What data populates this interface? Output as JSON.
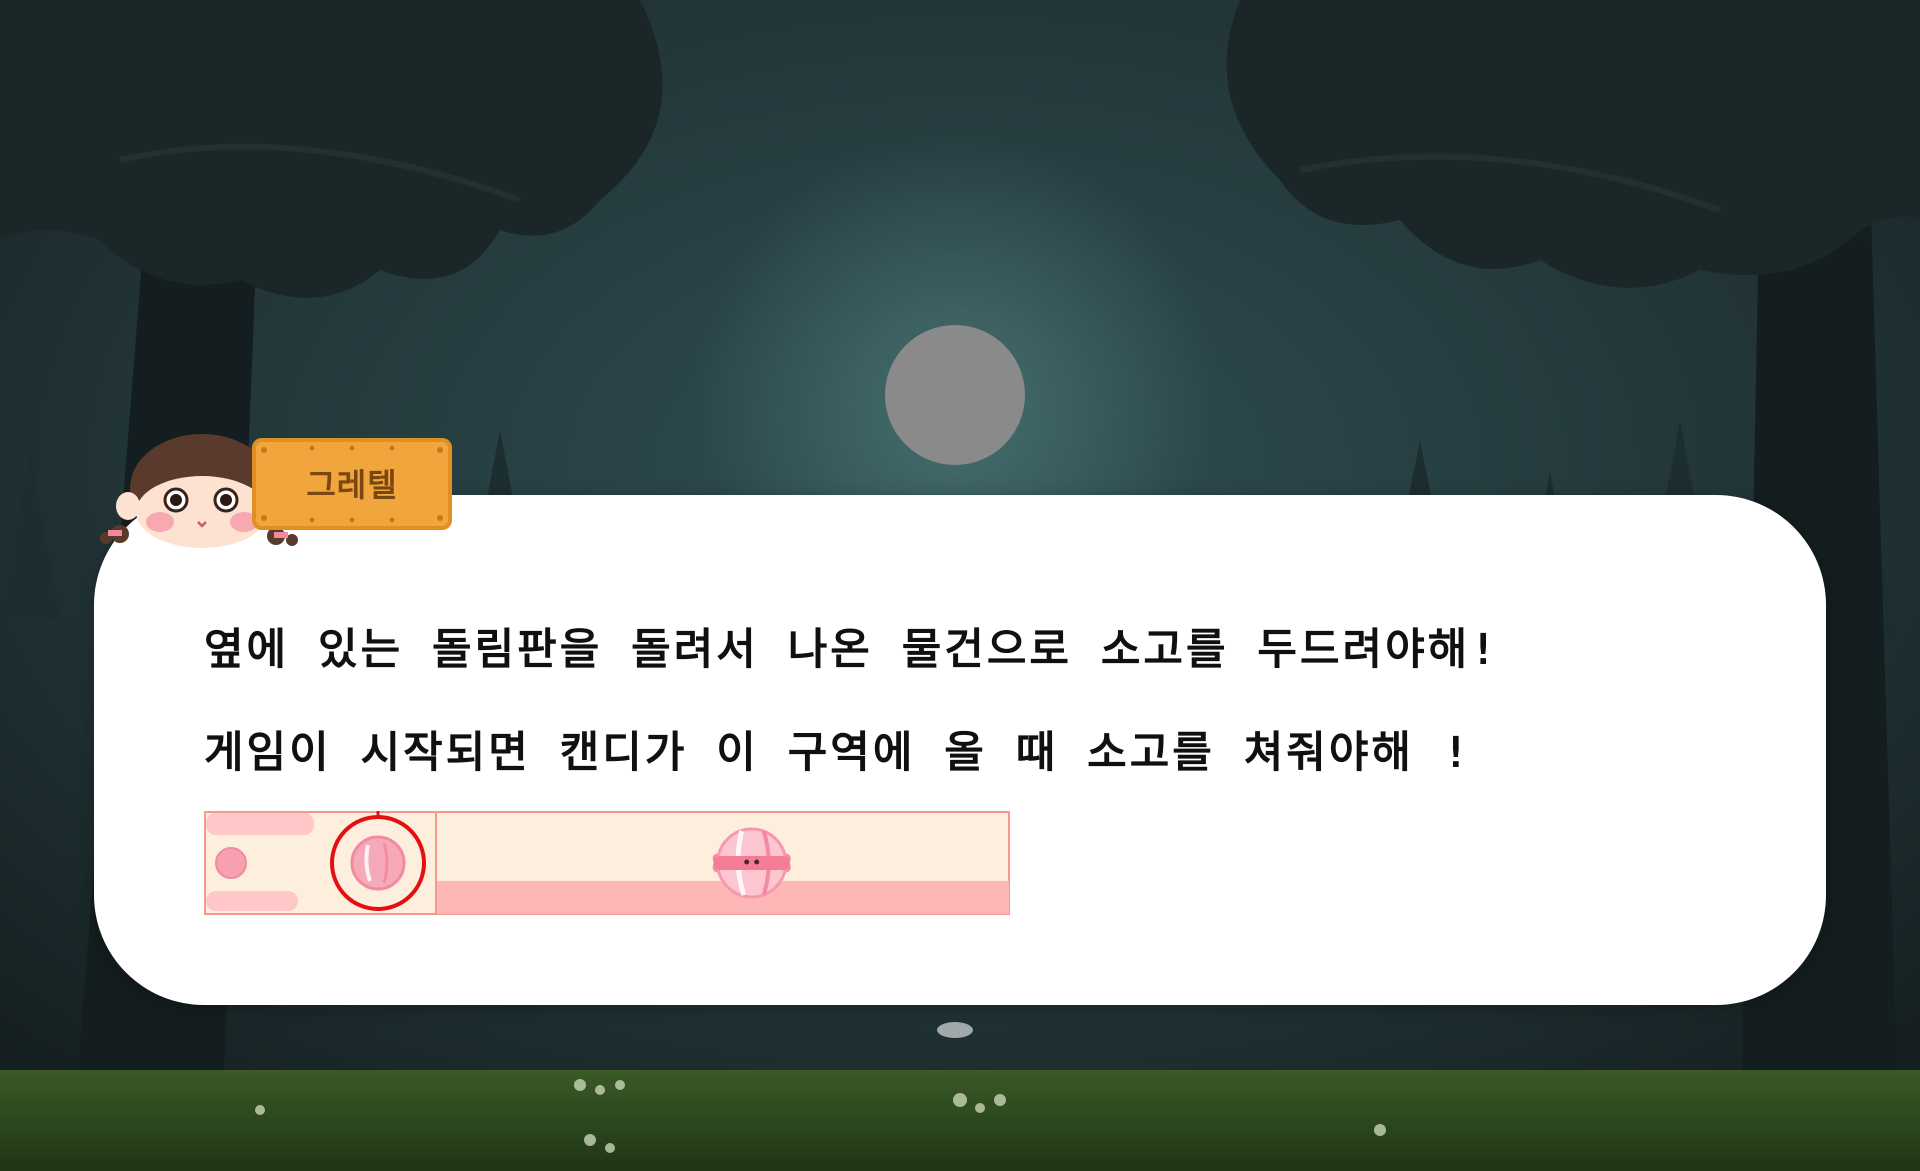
{
  "speaker": {
    "name": "그레텔"
  },
  "dialog": {
    "line1": "옆에 있는 돌림판을 돌려서 나온 물건으로 소고를 두드려야해!",
    "line2": "게임이 시작되면 캔디가 이 구역에 올 때 소고를 쳐줘야해 !"
  },
  "rhythm_bar": {
    "candy_position": 0.55,
    "hit_zone_icon": "candy-target-icon",
    "colors": {
      "bar_fill": "#fdeedd",
      "bar_border": "#f59a88",
      "stripe": "#ffb6b6",
      "target_ring": "#e41010"
    }
  },
  "colors": {
    "dialog_bg": "#ffffff",
    "badge": "#f0a63c",
    "badge_text": "#7a4710",
    "moon": "#8a8a8a"
  }
}
